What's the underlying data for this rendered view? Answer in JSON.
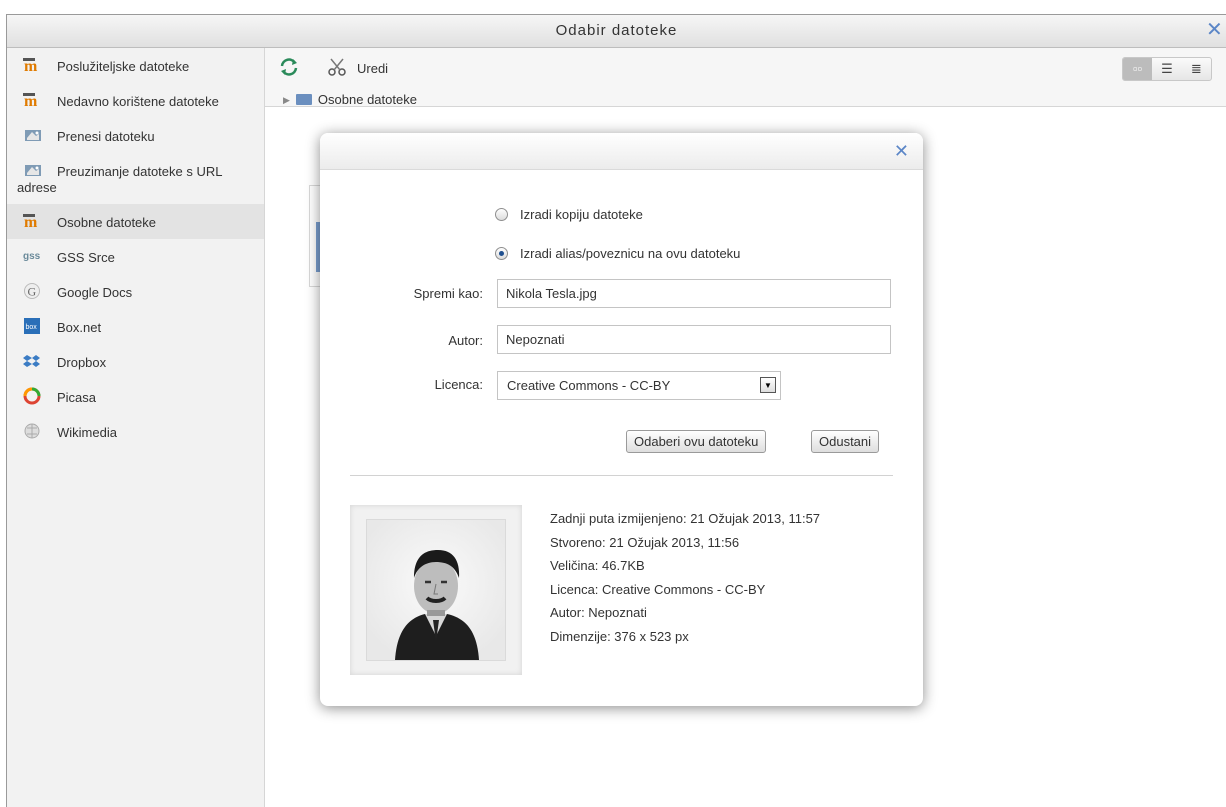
{
  "window": {
    "title": "Odabir datoteke"
  },
  "sidebar": {
    "items": [
      {
        "label": "Poslužiteljske datoteke",
        "icon": "moodle-icon"
      },
      {
        "label": "Nedavno korištene datoteke",
        "icon": "moodle-icon"
      },
      {
        "label": "Prenesi datoteku",
        "icon": "upload-icon"
      },
      {
        "label": "Preuzimanje datoteke s URL adrese",
        "icon": "download-icon"
      },
      {
        "label": "Osobne datoteke",
        "icon": "moodle-icon",
        "active": true
      },
      {
        "label": "GSS Srce",
        "icon": "gss-icon"
      },
      {
        "label": "Google Docs",
        "icon": "google-icon"
      },
      {
        "label": "Box.net",
        "icon": "box-icon"
      },
      {
        "label": "Dropbox",
        "icon": "dropbox-icon"
      },
      {
        "label": "Picasa",
        "icon": "picasa-icon"
      },
      {
        "label": "Wikimedia",
        "icon": "wikimedia-icon"
      }
    ]
  },
  "toolbar": {
    "edit_label": "Uredi",
    "breadcrumb": "Osobne datoteke"
  },
  "dialog": {
    "radio_copy": "Izradi kopiju datoteke",
    "radio_alias": "Izradi alias/poveznicu na ovu datoteku",
    "selected_radio": "alias",
    "save_as_label": "Spremi kao:",
    "save_as_value": "Nikola Tesla.jpg",
    "author_label": "Autor:",
    "author_value": "Nepoznati",
    "license_label": "Licenca:",
    "license_value": "Creative Commons - CC-BY",
    "select_button": "Odaberi ovu datoteku",
    "cancel_button": "Odustani",
    "info": {
      "modified": "Zadnji puta izmijenjeno: 21 Ožujak 2013, 11:57",
      "created": "Stvoreno: 21 Ožujak 2013, 11:56",
      "size": "Veličina: 46.7KB",
      "license": "Licenca: Creative Commons - CC-BY",
      "author": "Autor: Nepoznati",
      "dimensions": "Dimenzije: 376 x 523 px"
    }
  },
  "colors": {
    "accent": "#5b86c7",
    "sidebar_bg": "#f2f2f2",
    "moodle_orange": "#e07b00"
  }
}
